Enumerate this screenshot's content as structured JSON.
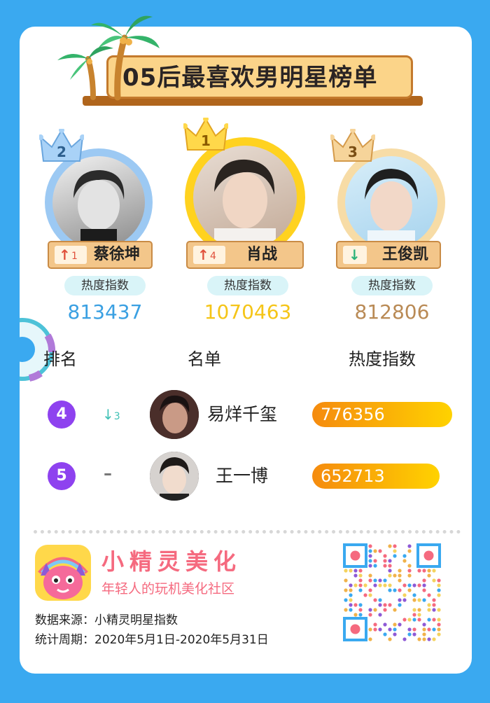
{
  "title": "05后最喜欢男明星榜单",
  "podium": [
    {
      "rank": "2",
      "delta_arrow": "↑",
      "delta": "1",
      "name": "蔡徐坤",
      "pill": "热度指数",
      "score": "813437",
      "score_color": "#3aa0e2"
    },
    {
      "rank": "1",
      "delta_arrow": "↑",
      "delta": "4",
      "name": "肖战",
      "pill": "热度指数",
      "score": "1070463",
      "score_color": "#f5c518"
    },
    {
      "rank": "3",
      "delta_arrow": "↓",
      "delta": "",
      "name": "王俊凯",
      "pill": "热度指数",
      "score": "812806",
      "score_color": "#b98a55"
    }
  ],
  "table": {
    "headers": {
      "rank": "排名",
      "name": "名单",
      "score": "热度指数"
    },
    "rows": [
      {
        "rank": "4",
        "delta_arrow": "↓",
        "delta": "3",
        "name": "易烊千玺",
        "score": "776356",
        "fill": 0.73
      },
      {
        "rank": "5",
        "delta_arrow": "–",
        "delta": "",
        "name": "王一博",
        "score": "652713",
        "fill": 0.61
      }
    ]
  },
  "footer": {
    "brand": "小精灵美化",
    "slogan": "年轻人的玩机美化社区",
    "source": "数据来源：小精灵明星指数",
    "period": "统计周期：2020年5月1日-2020年5月31日"
  },
  "colors": {
    "background": "#3aa9f0",
    "rank_badge": "#8e42ef",
    "bar_start": "#f58b0e",
    "bar_end": "#ffd200",
    "brand": "#f56a7f"
  }
}
